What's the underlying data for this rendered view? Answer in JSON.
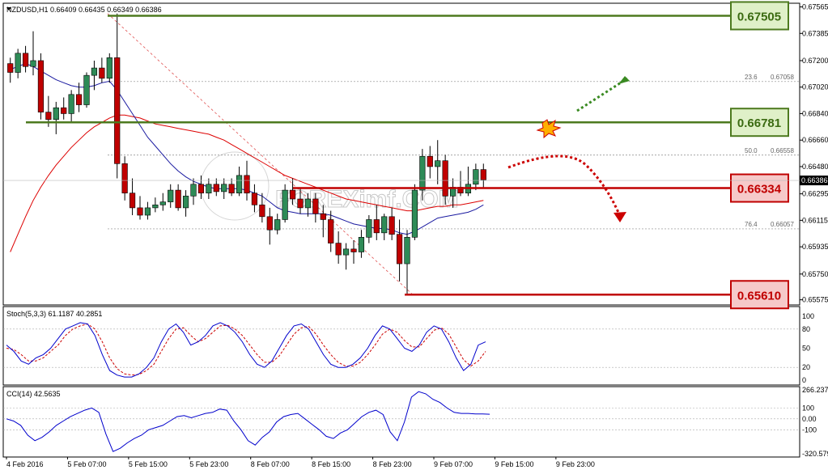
{
  "chart_data": [
    {
      "type": "candlestick",
      "panel": "price",
      "symbol_header": "NZDUSD,H1  0.66409 0.66435 0.66349 0.66386",
      "y_ticks": [
        "0.67565",
        "0.67385",
        "0.67200",
        "0.67020",
        "0.66840",
        "0.66660",
        "0.66480",
        "0.66295",
        "0.66115",
        "0.65935",
        "0.65750",
        "0.65575"
      ],
      "ylim": [
        0.6554,
        0.6759
      ],
      "current_price_label": "0.66386",
      "current_price": 0.66386,
      "x_ticks": [
        "4 Feb 2016",
        "5 Feb 07:00",
        "5 Feb 15:00",
        "5 Feb 23:00",
        "8 Feb 07:00",
        "8 Feb 15:00",
        "8 Feb 23:00",
        "9 Feb 07:00",
        "9 Feb 15:00",
        "9 Feb 23:00"
      ],
      "candles": [
        [
          0.6718,
          0.6722,
          0.6705,
          0.6712
        ],
        [
          0.6712,
          0.6728,
          0.6708,
          0.6725
        ],
        [
          0.6725,
          0.673,
          0.6712,
          0.6716
        ],
        [
          0.6716,
          0.674,
          0.671,
          0.672
        ],
        [
          0.672,
          0.6725,
          0.668,
          0.6685
        ],
        [
          0.6685,
          0.6696,
          0.6675,
          0.668
        ],
        [
          0.668,
          0.6692,
          0.667,
          0.6688
        ],
        [
          0.6688,
          0.6695,
          0.668,
          0.6684
        ],
        [
          0.6684,
          0.67,
          0.6678,
          0.6697
        ],
        [
          0.6697,
          0.6705,
          0.6685,
          0.669
        ],
        [
          0.669,
          0.6712,
          0.6688,
          0.671
        ],
        [
          0.671,
          0.672,
          0.67,
          0.6715
        ],
        [
          0.6715,
          0.6722,
          0.6705,
          0.6708
        ],
        [
          0.6708,
          0.6725,
          0.6705,
          0.6722
        ],
        [
          0.6722,
          0.6752,
          0.664,
          0.665
        ],
        [
          0.665,
          0.6655,
          0.6625,
          0.663
        ],
        [
          0.663,
          0.664,
          0.6615,
          0.662
        ],
        [
          0.662,
          0.6628,
          0.6612,
          0.6615
        ],
        [
          0.6615,
          0.6624,
          0.6612,
          0.662
        ],
        [
          0.662,
          0.6627,
          0.6617,
          0.6622
        ],
        [
          0.6622,
          0.663,
          0.6618,
          0.6624
        ],
        [
          0.6624,
          0.6636,
          0.662,
          0.6632
        ],
        [
          0.6632,
          0.6636,
          0.6618,
          0.662
        ],
        [
          0.662,
          0.6632,
          0.6614,
          0.6628
        ],
        [
          0.6628,
          0.664,
          0.6622,
          0.6636
        ],
        [
          0.6636,
          0.6642,
          0.6626,
          0.663
        ],
        [
          0.663,
          0.664,
          0.6626,
          0.6636
        ],
        [
          0.6636,
          0.664,
          0.6628,
          0.6631
        ],
        [
          0.6631,
          0.664,
          0.6626,
          0.6636
        ],
        [
          0.6636,
          0.664,
          0.6628,
          0.663
        ],
        [
          0.663,
          0.6648,
          0.6628,
          0.6642
        ],
        [
          0.6642,
          0.6652,
          0.6625,
          0.663
        ],
        [
          0.663,
          0.6636,
          0.6617,
          0.6622
        ],
        [
          0.6622,
          0.663,
          0.661,
          0.6614
        ],
        [
          0.6614,
          0.662,
          0.6595,
          0.6605
        ],
        [
          0.6605,
          0.6616,
          0.6602,
          0.6612
        ],
        [
          0.6612,
          0.6636,
          0.661,
          0.6632
        ],
        [
          0.6632,
          0.664,
          0.6622,
          0.6626
        ],
        [
          0.6626,
          0.6634,
          0.6616,
          0.662
        ],
        [
          0.662,
          0.663,
          0.6614,
          0.6626
        ],
        [
          0.6626,
          0.663,
          0.661,
          0.6616
        ],
        [
          0.6616,
          0.6622,
          0.66,
          0.6612
        ],
        [
          0.6612,
          0.6618,
          0.659,
          0.6596
        ],
        [
          0.6596,
          0.6604,
          0.6582,
          0.6588
        ],
        [
          0.6588,
          0.6596,
          0.6578,
          0.6592
        ],
        [
          0.6592,
          0.6598,
          0.6582,
          0.659
        ],
        [
          0.659,
          0.6605,
          0.6586,
          0.66
        ],
        [
          0.66,
          0.6615,
          0.6596,
          0.6612
        ],
        [
          0.6612,
          0.6622,
          0.6598,
          0.6603
        ],
        [
          0.6603,
          0.6616,
          0.6598,
          0.6614
        ],
        [
          0.6614,
          0.662,
          0.6598,
          0.6602
        ],
        [
          0.6602,
          0.6612,
          0.657,
          0.6582
        ],
        [
          0.6582,
          0.6605,
          0.6561,
          0.66
        ],
        [
          0.66,
          0.6636,
          0.6598,
          0.6632
        ],
        [
          0.6632,
          0.666,
          0.6625,
          0.6655
        ],
        [
          0.6655,
          0.6662,
          0.664,
          0.6648
        ],
        [
          0.6648,
          0.6666,
          0.6636,
          0.6652
        ],
        [
          0.6652,
          0.6656,
          0.6622,
          0.6628
        ],
        [
          0.6628,
          0.664,
          0.662,
          0.6634
        ],
        [
          0.6634,
          0.6645,
          0.6628,
          0.663
        ],
        [
          0.663,
          0.6648,
          0.6628,
          0.6636
        ],
        [
          0.6636,
          0.665,
          0.6632,
          0.6646
        ],
        [
          0.6646,
          0.665,
          0.6634,
          0.6639
        ]
      ],
      "ma_blue": [
        0.6714,
        0.6716,
        0.6718,
        0.6716,
        0.6713,
        0.671,
        0.6707,
        0.6705,
        0.6703,
        0.6702,
        0.6702,
        0.6703,
        0.6705,
        0.6706,
        0.67,
        0.6692,
        0.6684,
        0.6676,
        0.6668,
        0.6662,
        0.6656,
        0.665,
        0.6645,
        0.6641,
        0.6638,
        0.6636,
        0.6634,
        0.6633,
        0.6633,
        0.6633,
        0.6633,
        0.6632,
        0.663,
        0.6628,
        0.6624,
        0.662,
        0.6618,
        0.6617,
        0.6616,
        0.6616,
        0.6616,
        0.6616,
        0.6615,
        0.6613,
        0.6611,
        0.6609,
        0.6608,
        0.6607,
        0.6606,
        0.6606,
        0.6605,
        0.6603,
        0.6602,
        0.6604,
        0.6607,
        0.661,
        0.6613,
        0.6614,
        0.6615,
        0.6616,
        0.6617,
        0.6619,
        0.6622
      ],
      "ma_red": [
        0.659,
        0.6602,
        0.6614,
        0.6625,
        0.6634,
        0.6642,
        0.6649,
        0.6655,
        0.6661,
        0.6666,
        0.6671,
        0.6675,
        0.6678,
        0.6681,
        0.6683,
        0.6683,
        0.6682,
        0.6681,
        0.6679,
        0.6677,
        0.6676,
        0.6675,
        0.6674,
        0.6673,
        0.6672,
        0.6671,
        0.667,
        0.6668,
        0.6666,
        0.6663,
        0.666,
        0.6657,
        0.6654,
        0.6651,
        0.6648,
        0.6645,
        0.6642,
        0.664,
        0.6638,
        0.6636,
        0.6634,
        0.6632,
        0.663,
        0.6628,
        0.6626,
        0.6625,
        0.6624,
        0.6623,
        0.6622,
        0.6621,
        0.662,
        0.6619,
        0.6618,
        0.6618,
        0.6619,
        0.662,
        0.6621,
        0.6621,
        0.6622,
        0.6622,
        0.6623,
        0.6624,
        0.6625
      ],
      "levels": [
        {
          "value": 0.67505,
          "label": "0.67505",
          "color": "#4d7a1f",
          "box_fill": "#dff0c8"
        },
        {
          "value": 0.66781,
          "label": "0.66781",
          "color": "#4d7a1f",
          "box_fill": "#dff0c8"
        },
        {
          "value": 0.66334,
          "label": "0.66334",
          "color": "#c00000",
          "box_fill": "#f6c9c9"
        },
        {
          "value": 0.6561,
          "label": "0.65610",
          "color": "#c00000",
          "box_fill": "#f6c9c9"
        }
      ],
      "fibonacci": [
        {
          "ratio": "23.6",
          "value_label": "0.67058",
          "value": 0.67058
        },
        {
          "ratio": "50.0",
          "value_label": "0.66558",
          "value": 0.66558
        },
        {
          "ratio": "76.4",
          "value_label": "0.66057",
          "value": 0.66057
        }
      ],
      "watermark": "FOREXimf.COM"
    },
    {
      "type": "line",
      "panel": "stochastic",
      "label": "Stoch(5,3,3) 61.1187 40.2851",
      "y_ticks": [
        "100",
        "80",
        "50",
        "20",
        "0"
      ],
      "ylim": [
        0,
        100
      ],
      "series": [
        {
          "color": "#0000cc",
          "values": [
            55,
            45,
            30,
            25,
            35,
            40,
            50,
            65,
            80,
            85,
            90,
            88,
            70,
            40,
            15,
            8,
            5,
            5,
            10,
            20,
            35,
            60,
            80,
            88,
            75,
            55,
            60,
            70,
            85,
            90,
            85,
            75,
            60,
            40,
            25,
            20,
            30,
            50,
            70,
            85,
            88,
            80,
            60,
            40,
            25,
            20,
            20,
            25,
            35,
            50,
            70,
            85,
            80,
            65,
            50,
            45,
            55,
            75,
            85,
            80,
            60,
            35,
            15,
            25,
            55,
            60
          ]
        },
        {
          "color": "#cc0000",
          "values": [
            50,
            48,
            40,
            30,
            30,
            35,
            45,
            55,
            70,
            80,
            85,
            88,
            80,
            60,
            35,
            18,
            10,
            8,
            9,
            15,
            25,
            45,
            65,
            80,
            82,
            70,
            60,
            65,
            75,
            85,
            86,
            80,
            70,
            55,
            40,
            28,
            28,
            38,
            55,
            72,
            82,
            84,
            72,
            55,
            40,
            28,
            22,
            22,
            28,
            40,
            55,
            72,
            80,
            75,
            62,
            52,
            52,
            65,
            78,
            82,
            72,
            52,
            32,
            22,
            30,
            45
          ]
        }
      ]
    },
    {
      "type": "line",
      "panel": "cci",
      "label": "CCI(14) 42.5635",
      "y_ticks": [
        "266.237",
        "100",
        "0.00",
        "-100",
        "-320.579"
      ],
      "ylim": [
        -320.579,
        266.237
      ],
      "series": [
        {
          "color": "#0000cc",
          "values": [
            0,
            -20,
            -60,
            -150,
            -200,
            -170,
            -120,
            -60,
            -20,
            20,
            50,
            80,
            100,
            60,
            -140,
            -300,
            -270,
            -220,
            -180,
            -150,
            -100,
            -80,
            -60,
            -20,
            20,
            30,
            10,
            30,
            50,
            60,
            90,
            80,
            -20,
            -100,
            -200,
            -240,
            -170,
            -120,
            -30,
            20,
            40,
            50,
            0,
            -50,
            -100,
            -160,
            -180,
            -130,
            -100,
            -40,
            20,
            60,
            80,
            40,
            -120,
            -200,
            -30,
            200,
            250,
            230,
            180,
            150,
            100,
            60,
            50,
            50,
            45,
            45,
            42.5635
          ]
        }
      ]
    }
  ]
}
